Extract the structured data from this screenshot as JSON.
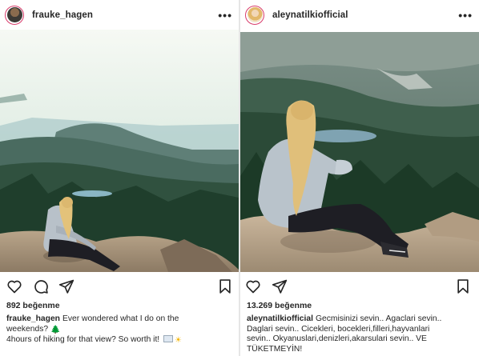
{
  "left_post": {
    "username": "frauke_hagen",
    "more_label": "•••",
    "likes_text": "892 beğenme",
    "caption_user": "frauke_hagen",
    "caption_line1": "Ever wondered what I do on the",
    "caption_line2": "weekends? ",
    "caption_line3": "4hours of hiking for that view? So worth it! ",
    "emoji_tree": "🌲",
    "emoji_sun": "☀"
  },
  "right_post": {
    "username": "aleynatilkiofficial",
    "more_label": "•••",
    "likes_text": "13.269 beğenme",
    "caption_user": "aleynatilkiofficial",
    "caption_line1": "Gecmisinizi sevin.. Agaclari sevin..",
    "caption_line2": "Daglari sevin.. Cicekleri, bocekleri,filleri,hayvanlari",
    "caption_line3": "sevin.. Okyanuslari,denizleri,akarsulari sevin.. VE",
    "caption_line4": "TÜKETMEYİN!"
  },
  "colors": {
    "text": "#262626",
    "story_ring": "#d93b6b",
    "divider": "#e6e6e6"
  },
  "icons": [
    "heart-icon",
    "comment-icon",
    "share-icon",
    "bookmark-icon",
    "more-options-icon"
  ]
}
